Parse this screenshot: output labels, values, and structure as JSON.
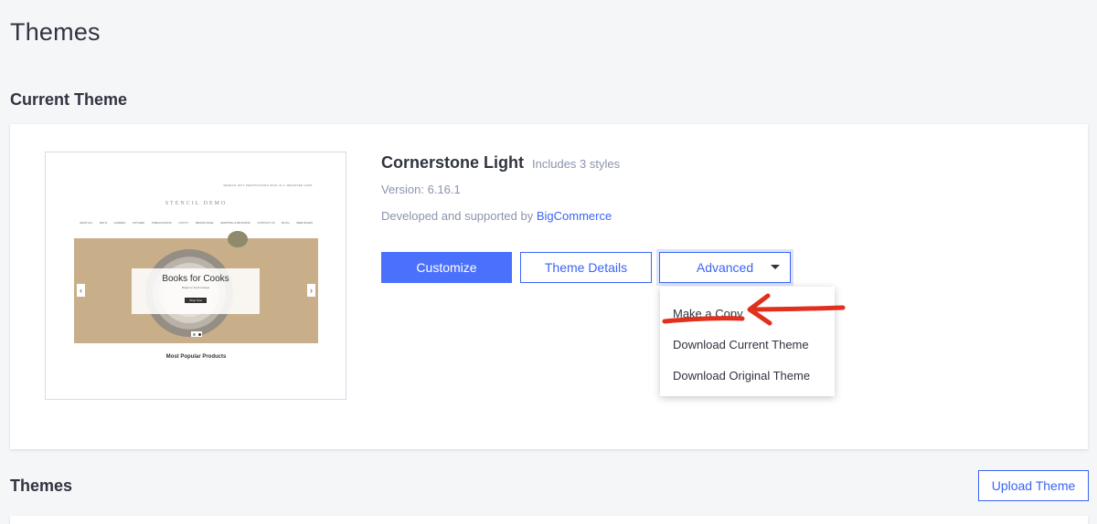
{
  "page": {
    "title": "Themes"
  },
  "current_theme": {
    "section_title": "Current Theme",
    "name": "Cornerstone Light",
    "styles_note": "Includes 3 styles",
    "version": "Version: 6.16.1",
    "developed_prefix": "Developed and supported by ",
    "developer_link": "BigCommerce",
    "buttons": {
      "customize": "Customize",
      "theme_details": "Theme Details",
      "advanced": "Advanced"
    },
    "advanced_menu": [
      "Make a Copy",
      "Download Current Theme",
      "Download Original Theme"
    ],
    "preview": {
      "top_links": "SEARCH   GIFT CERTIFICATES   SIGN IN or REGISTER   CART",
      "brand": "STENCIL DEMO",
      "categories": [
        "SHOP ALL",
        "BATH",
        "GARDEN",
        "KITCHEN",
        "PUBLICATIONS",
        "UTILITY",
        "BRAND PAGE",
        "SHIPPING & RETURNS",
        "CONTACT US",
        "BLOG",
        "WEB PAGES"
      ],
      "slide_title": "Books for Cooks",
      "slide_subtitle": "Bright on fresh recipes",
      "slide_button": "Shop Now",
      "popular_heading": "Most Popular Products"
    }
  },
  "themes_section": {
    "title": "Themes",
    "upload_button": "Upload Theme"
  },
  "colors": {
    "primary": "#4b71fc",
    "link": "#3c64f4",
    "annotation_arrow": "#e0301e"
  }
}
